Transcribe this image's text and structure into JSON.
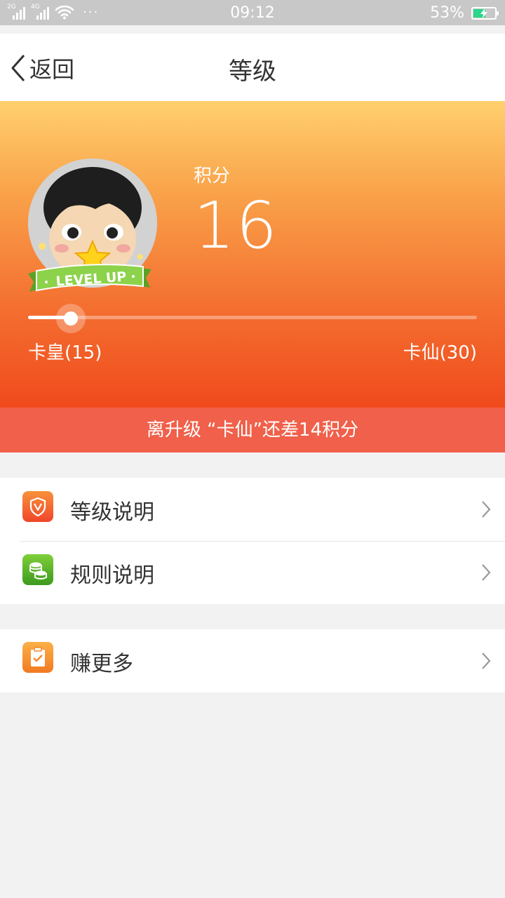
{
  "status_bar": {
    "network_1": "2G",
    "network_2": "4G",
    "more": "···",
    "time": "09:12",
    "battery_percent": "53%",
    "battery_level": 0.53
  },
  "nav": {
    "back_label": "返回",
    "title": "等级"
  },
  "hero": {
    "badge_text": "LEVEL UP",
    "points_label": "积分",
    "points_value": "16",
    "current_level": "卡皇(15)",
    "next_level": "卡仙(30)",
    "progress_fraction": 0.095
  },
  "notice": {
    "text": "离升级 “卡仙”还差14积分"
  },
  "menu": {
    "items": [
      {
        "label": "等级说明",
        "icon": "shield-v-icon",
        "color": "#f2562c"
      },
      {
        "label": "规则说明",
        "icon": "coins-icon",
        "color": "#5bb12f"
      },
      {
        "label": "赚更多",
        "icon": "clipboard-check-icon",
        "color": "#f5882a"
      }
    ]
  },
  "colors": {
    "hero_top": "#ffd06e",
    "hero_bottom": "#f04a1c",
    "notice_bg": "#f0604a",
    "page_bg": "#f2f2f2"
  }
}
